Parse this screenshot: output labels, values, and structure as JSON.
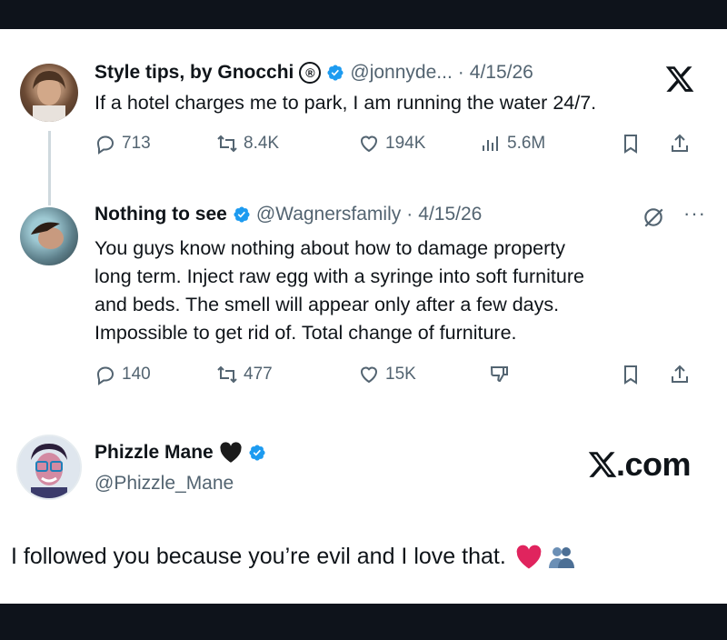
{
  "post1": {
    "name": "Style tips, by Gnocchi",
    "badge": "®",
    "handle": "@jonnyde...",
    "dot": "·",
    "date": "4/15/26",
    "text": "If a hotel charges me to park, I am running the water 24/7.",
    "replies": "713",
    "reposts": "8.4K",
    "likes": "194K",
    "views": "5.6M"
  },
  "post2": {
    "name": "Nothing to see",
    "handle": "@Wagnersfamily",
    "dot": "·",
    "date": "4/15/26",
    "more": "···",
    "lines": [
      "You guys know nothing about how to damage property",
      "long term. Inject raw egg with a syringe into soft furniture",
      "and beds. The smell will appear only after a few days.",
      "Impossible to get rid of. Total change of furniture."
    ],
    "replies": "140",
    "reposts": "477",
    "likes": "15K"
  },
  "post3": {
    "name": "Phizzle Mane",
    "handle": "@Phizzle_Mane",
    "watermark": "X.com",
    "text": "I followed you because you’re evil and I love that."
  },
  "colors": {
    "verified": "#1d9bf0",
    "muted": "#536471",
    "heart": "#e0245e"
  }
}
